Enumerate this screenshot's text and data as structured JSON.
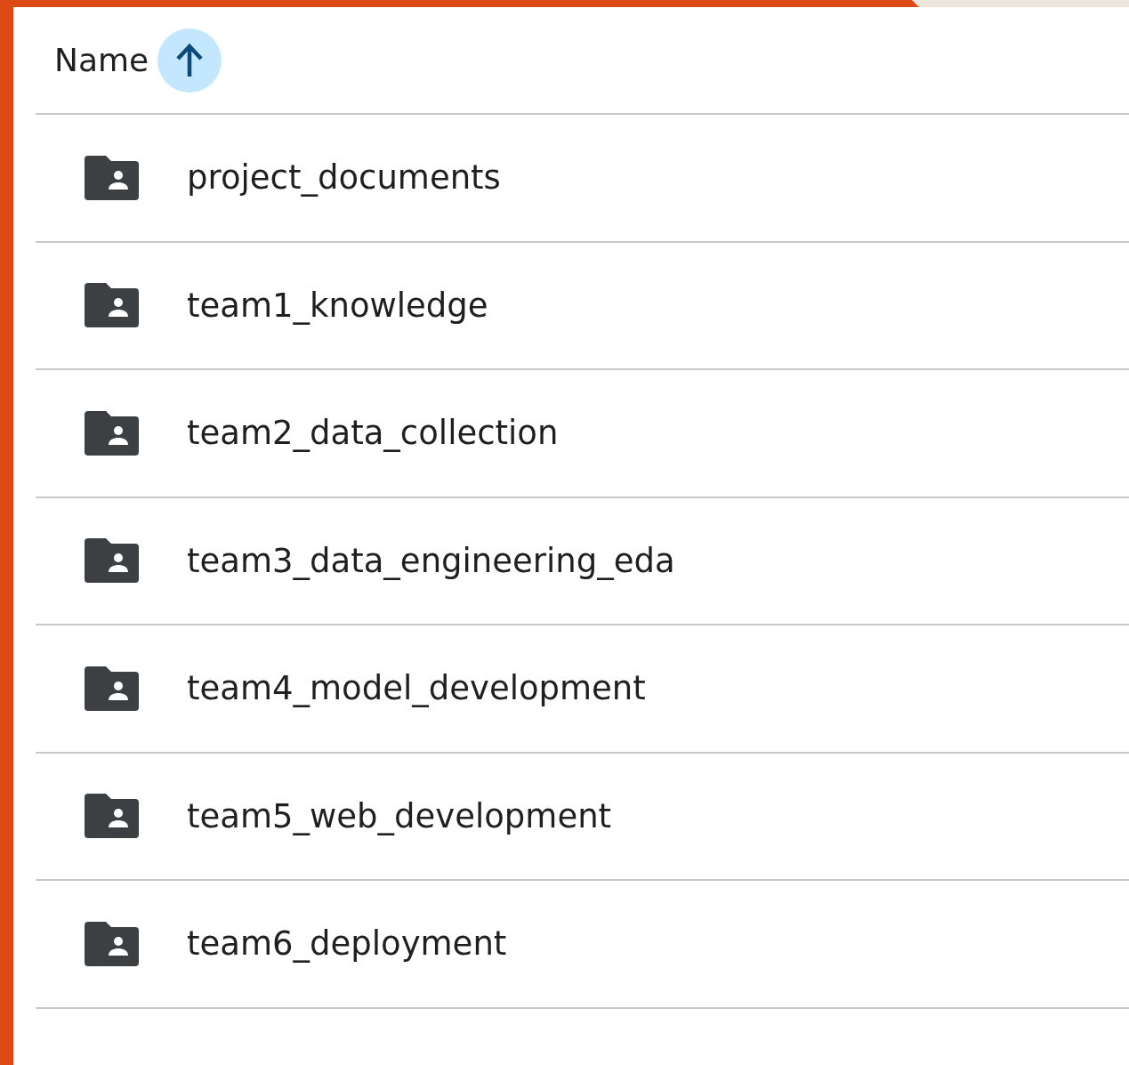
{
  "header": {
    "label": "Name",
    "sort_ascending": true
  },
  "rows": [
    {
      "name": "project_documents",
      "kind": "shared-folder"
    },
    {
      "name": "team1_knowledge",
      "kind": "shared-folder"
    },
    {
      "name": "team2_data_collection",
      "kind": "shared-folder"
    },
    {
      "name": "team3_data_engineering_eda",
      "kind": "shared-folder"
    },
    {
      "name": "team4_model_development",
      "kind": "shared-folder"
    },
    {
      "name": "team5_web_development",
      "kind": "shared-folder"
    },
    {
      "name": "team6_deployment",
      "kind": "shared-folder"
    }
  ]
}
